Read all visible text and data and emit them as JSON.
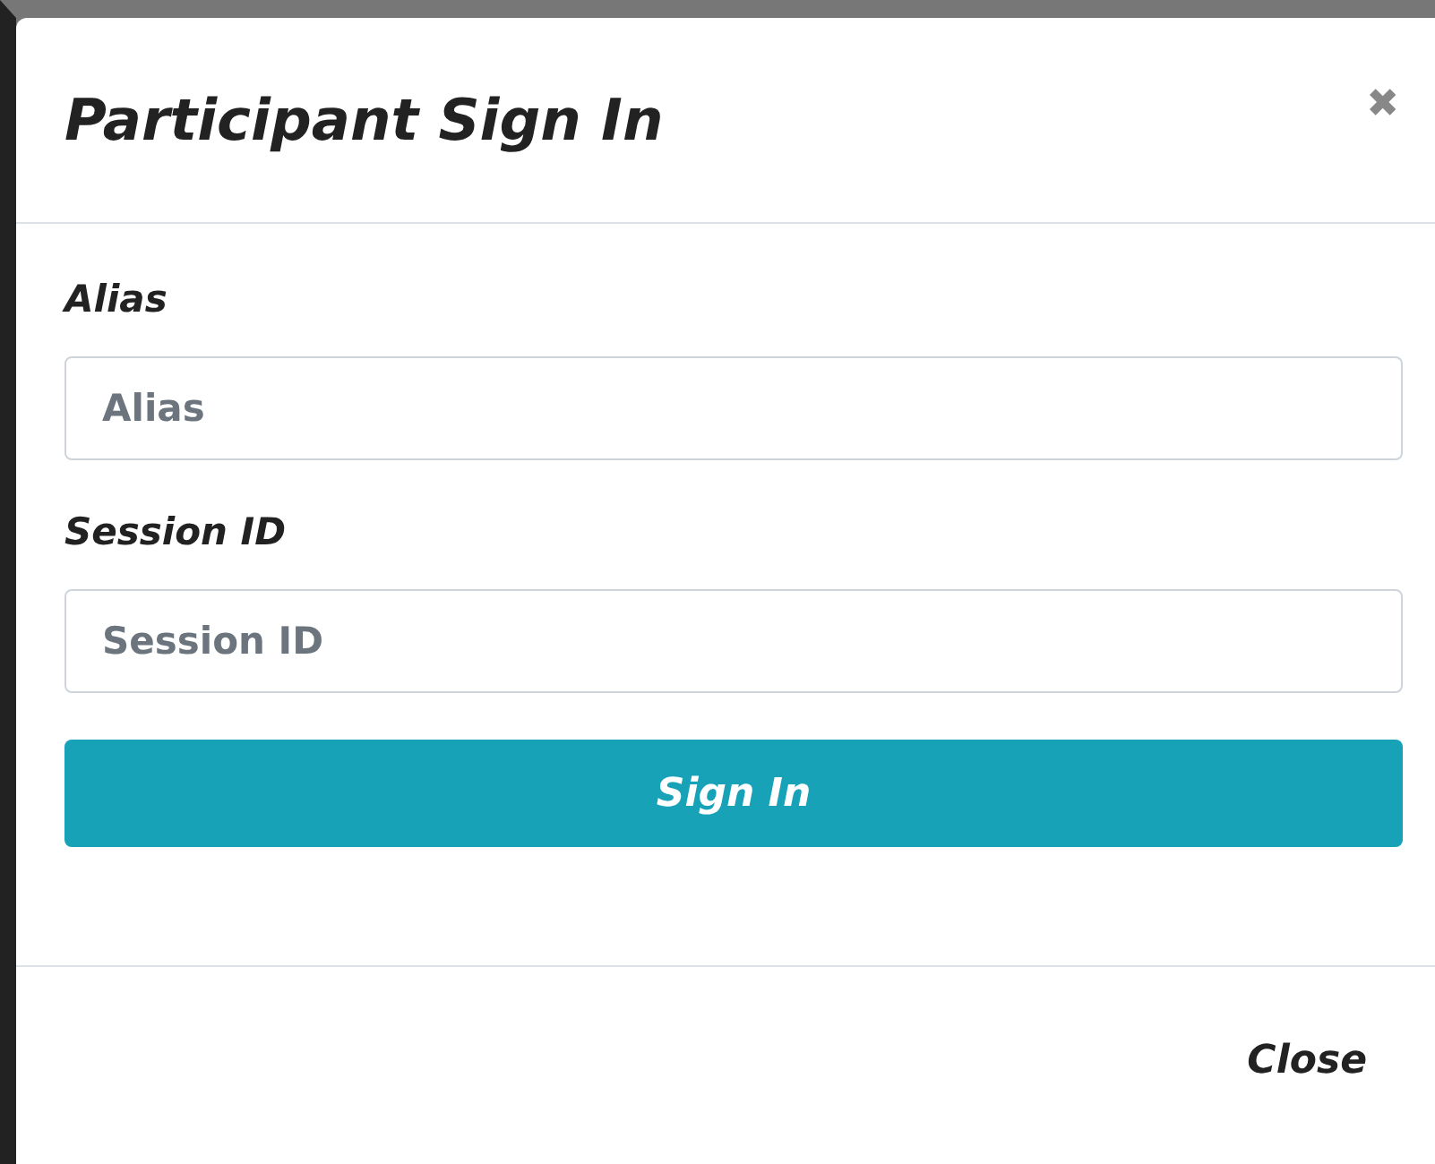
{
  "dialog": {
    "title": "Participant Sign In",
    "close_icon": "✖"
  },
  "fields": [
    {
      "label": "Alias",
      "placeholder": "Alias"
    },
    {
      "label": "Session ID",
      "placeholder": "Session ID"
    }
  ],
  "submit_button": "Sign In",
  "footer_button": "Close"
}
